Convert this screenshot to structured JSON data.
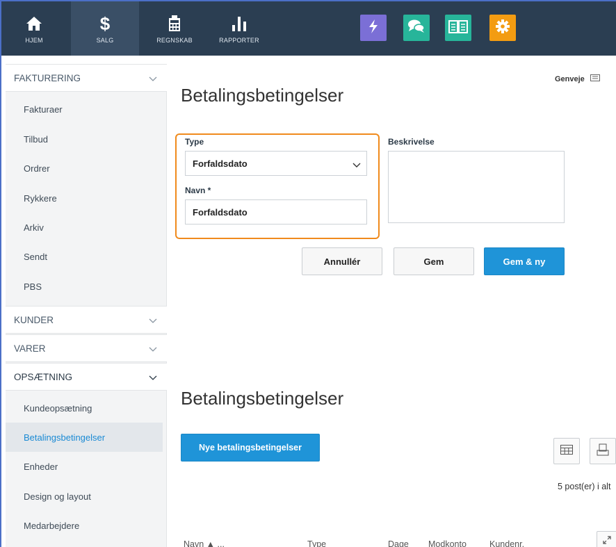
{
  "nav": {
    "items": [
      {
        "label": "HJEM",
        "icon": "home-icon"
      },
      {
        "label": "SALG",
        "icon": "dollar-icon"
      },
      {
        "label": "REGNSKAB",
        "icon": "calculator-icon"
      },
      {
        "label": "RAPPORTER",
        "icon": "bar-chart-icon"
      }
    ],
    "apps": [
      {
        "icon": "lightning-icon",
        "color": "#7b6fd6"
      },
      {
        "icon": "chat-icon",
        "color": "#27b59a"
      },
      {
        "icon": "book-icon",
        "color": "#27b59a"
      },
      {
        "icon": "gear-icon",
        "color": "#f39c12"
      }
    ]
  },
  "sidebar": {
    "sections": [
      {
        "label": "FAKTURERING",
        "expanded": true
      },
      {
        "label": "KUNDER",
        "expanded": false
      },
      {
        "label": "VARER",
        "expanded": false
      },
      {
        "label": "OPSÆTNING",
        "expanded": true
      }
    ],
    "faktura_items": [
      "Fakturaer",
      "Tilbud",
      "Ordrer",
      "Rykkere",
      "Arkiv",
      "Sendt",
      "PBS"
    ],
    "setup_items": [
      "Kundeopsætning",
      "Betalingsbetingelser",
      "Enheder",
      "Design og layout",
      "Medarbejdere"
    ],
    "active_item": "Betalingsbetingelser"
  },
  "main": {
    "shortcut_label": "Genveje",
    "form_title": "Betalingsbetingelser",
    "type_label": "Type",
    "type_value": "Forfaldsdato",
    "name_label": "Navn *",
    "name_value": "Forfaldsdato",
    "description_label": "Beskrivelse",
    "description_value": "",
    "cancel_label": "Annullér",
    "save_label": "Gem",
    "save_new_label": "Gem & ny",
    "list_title": "Betalingsbetingelser",
    "new_button_label": "Nye betalingsbetingelser",
    "count_text": "5 post(er) i alt",
    "columns": [
      "Navn ▲ ...",
      "Type",
      "Dage",
      "Modkonto",
      "Kundenr."
    ]
  },
  "colors": {
    "topbar": "#2b3e52",
    "accent": "#1f94d8",
    "highlight_frame": "#f08a1c"
  }
}
